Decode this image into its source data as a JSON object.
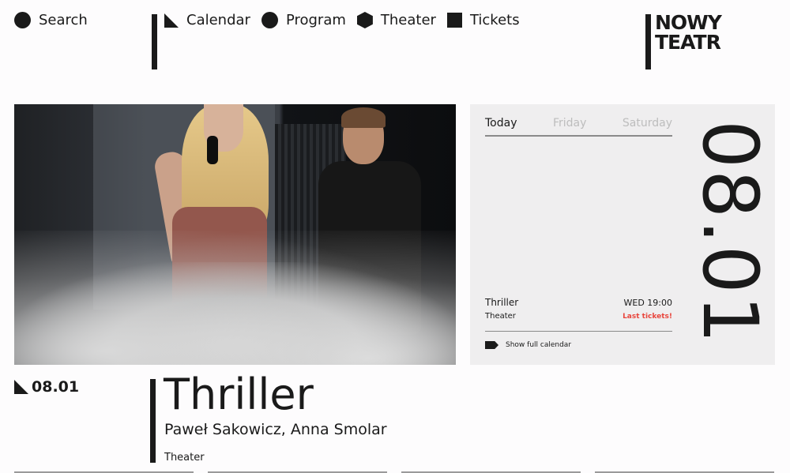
{
  "nav": {
    "search_label": "Search",
    "items": [
      {
        "label": "Calendar",
        "icon": "triangle-icon"
      },
      {
        "label": "Program",
        "icon": "circle-icon"
      },
      {
        "label": "Theater",
        "icon": "hexagon-icon"
      },
      {
        "label": "Tickets",
        "icon": "square-icon"
      }
    ]
  },
  "logo": {
    "line1": "NOWY",
    "line2": "TEATR"
  },
  "calendar": {
    "tabs": [
      "Today",
      "Friday",
      "Saturday"
    ],
    "active_tab": "Today",
    "event": {
      "title": "Thriller",
      "venue": "Theater",
      "time": "WED 19:00",
      "status": "Last tickets!"
    },
    "show_full_label": "Show full calendar",
    "big_date": "08.01"
  },
  "feature": {
    "date": "08.01",
    "title": "Thriller",
    "authors": "Paweł Sakowicz, Anna Smolar",
    "venue": "Theater"
  },
  "colors": {
    "text": "#1a1a1a",
    "panel_bg": "#efeeef",
    "accent_red": "#e8453c"
  }
}
